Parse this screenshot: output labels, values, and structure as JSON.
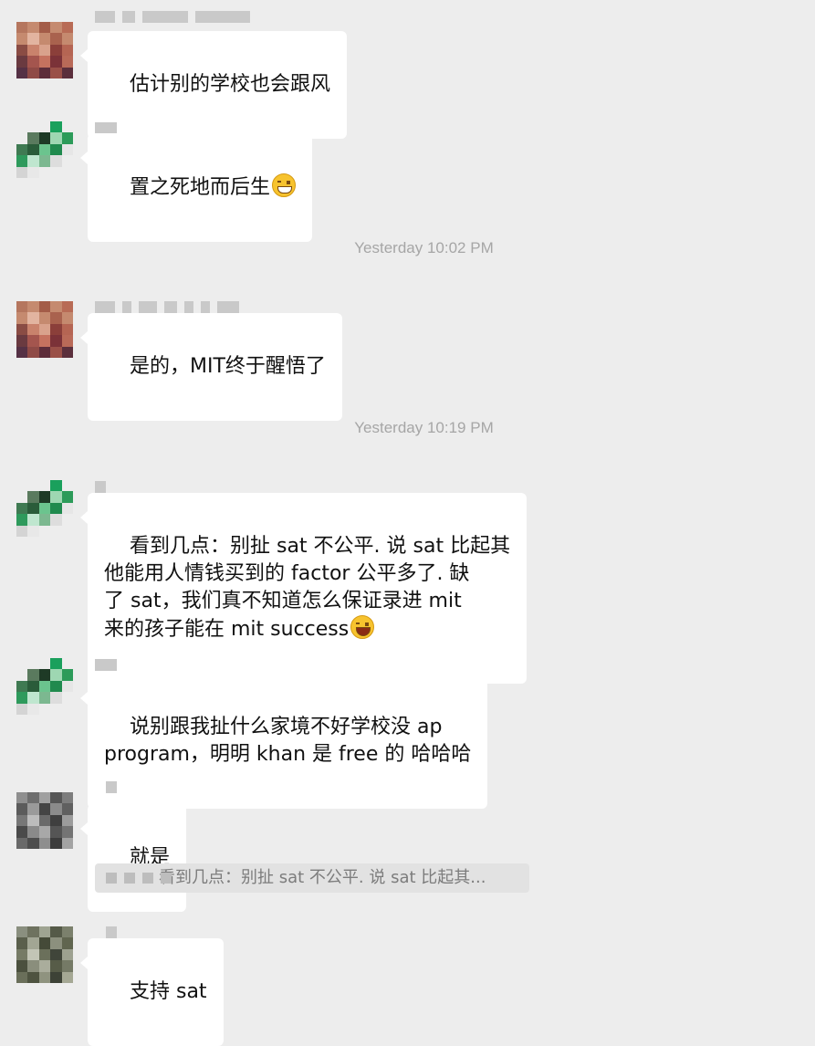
{
  "chat": {
    "timestamps": [
      "Yesterday 10:02 PM",
      "Yesterday 10:19 PM"
    ],
    "messages": [
      {
        "text": "估计别的学校也会跟风"
      },
      {
        "text": "置之死地而后生",
        "emoji": "grinning-face-emoji"
      },
      {
        "text": "是的，MIT终于醒悟了"
      },
      {
        "text": "看到几点：别扯 sat 不公平. 说 sat 比起其\n他能用人情钱买到的 factor 公平多了. 缺\n了 sat，我们真不知道怎么保证录进 mit\n来的孩子能在 mit success",
        "emoji": "rolling-laughing-emoji"
      },
      {
        "text": "说别跟我扯什么家境不好学校没 ap\nprogram，明明 khan 是 free 的 哈哈哈"
      },
      {
        "text": "就是"
      },
      {
        "text": "支持 sat"
      }
    ],
    "quote": {
      "text": "看到几点：别扯 sat 不公平. 说 sat 比起其..."
    }
  },
  "colors": {
    "background": "#ededed",
    "bubble": "#ffffff",
    "timestamp": "#a6a6a6"
  }
}
